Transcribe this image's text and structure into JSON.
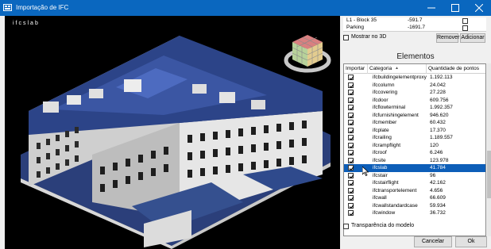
{
  "window": {
    "title": "Importação de IFC",
    "controls": {
      "minimize": "minimize-icon",
      "maximize": "maximize-icon",
      "close": "close-icon"
    },
    "accent_color": "#0a67bf"
  },
  "viewport": {
    "label": "ifcslab",
    "background": "#000000",
    "navcube_icon": "navigation-cube-icon"
  },
  "levels": [
    {
      "name": "L1 - Block 35",
      "elevation": "-591.7",
      "checked": false
    },
    {
      "name": "Parking",
      "elevation": "-1691.7",
      "checked": false
    }
  ],
  "show_3d": {
    "label": "Mostrar no 3D",
    "checked": false
  },
  "buttons": {
    "remove": "Remover",
    "add": "Adicionar",
    "cancel": "Cancelar",
    "ok": "Ok"
  },
  "elements": {
    "title": "Elementos",
    "columns": {
      "import": "Importar",
      "category": "Categoria",
      "count": "Quantidade de pontos"
    },
    "selected_color": "#0d5eb8",
    "rows": [
      {
        "category": "ifcbuildingelementproxy",
        "count": "1.192.113",
        "checked": true,
        "selected": false
      },
      {
        "category": "ifccolumn",
        "count": "24.042",
        "checked": true,
        "selected": false
      },
      {
        "category": "ifccovering",
        "count": "27.228",
        "checked": true,
        "selected": false
      },
      {
        "category": "ifcdoor",
        "count": "609.756",
        "checked": true,
        "selected": false
      },
      {
        "category": "ifcflowterminal",
        "count": "1.992.357",
        "checked": true,
        "selected": false
      },
      {
        "category": "ifcfurnishingelement",
        "count": "946.620",
        "checked": true,
        "selected": false
      },
      {
        "category": "ifcmember",
        "count": "60.432",
        "checked": true,
        "selected": false
      },
      {
        "category": "ifcplate",
        "count": "17.370",
        "checked": true,
        "selected": false
      },
      {
        "category": "ifcrailing",
        "count": "1.189.557",
        "checked": true,
        "selected": false
      },
      {
        "category": "ifcrampflight",
        "count": "120",
        "checked": true,
        "selected": false
      },
      {
        "category": "ifcroof",
        "count": "6.246",
        "checked": true,
        "selected": false
      },
      {
        "category": "ifcsite",
        "count": "123.978",
        "checked": true,
        "selected": false
      },
      {
        "category": "ifcslab",
        "count": "41.784",
        "checked": true,
        "selected": true
      },
      {
        "category": "ifcstair",
        "count": "96",
        "checked": true,
        "selected": false
      },
      {
        "category": "ifcstairflight",
        "count": "42.162",
        "checked": true,
        "selected": false
      },
      {
        "category": "ifctransportelement",
        "count": "4.656",
        "checked": true,
        "selected": false
      },
      {
        "category": "ifcwall",
        "count": "66.609",
        "checked": true,
        "selected": false
      },
      {
        "category": "ifcwallstandardcase",
        "count": "59.934",
        "checked": true,
        "selected": false
      },
      {
        "category": "ifcwindow",
        "count": "36.732",
        "checked": true,
        "selected": false
      }
    ]
  },
  "transparency": {
    "label": "Transparência do modelo",
    "checked": false
  }
}
